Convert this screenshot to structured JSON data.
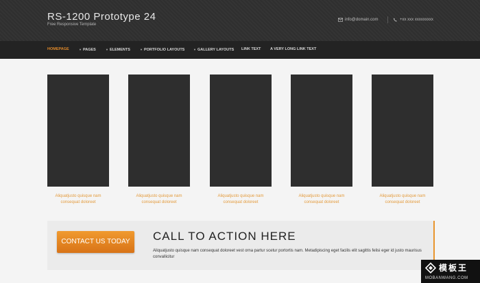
{
  "header": {
    "site_title": "RS-1200 Prototype 24",
    "site_subtitle": "Free Responsive Template",
    "email": "info@domain.com",
    "phone": "+xx xxx xxxxxxxxx"
  },
  "nav": {
    "items": [
      {
        "label": "HOMEPAGE",
        "active": true
      },
      {
        "label": "PAGES",
        "dropdown": true
      },
      {
        "label": "ELEMENTS",
        "dropdown": true
      },
      {
        "label": "PORTFOLIO LAYOUTS",
        "dropdown": true
      },
      {
        "label": "GALLERY LAYOUTS",
        "dropdown": true
      },
      {
        "label": "LINK TEXT"
      },
      {
        "label": "A VERY LONG LINK TEXT"
      }
    ]
  },
  "cards": [
    {
      "caption_line1": "Aliquatjusto quisque nam",
      "caption_line2": "consequat doloreet"
    },
    {
      "caption_line1": "Aliquatjusto quisque nam",
      "caption_line2": "consequat doloreet"
    },
    {
      "caption_line1": "Aliquatjusto quisque nam",
      "caption_line2": "consequat doloreet"
    },
    {
      "caption_line1": "Aliquatjusto quisque nam",
      "caption_line2": "consequat doloreet"
    },
    {
      "caption_line1": "Aliquatjusto quisque nam",
      "caption_line2": "consequat doloreet"
    }
  ],
  "cta": {
    "button_label": "CONTACT US TODAY",
    "title": "CALL TO ACTION HERE",
    "text": "Aliquatjusto quisque nam consequat doloreet vest orna partur scetur portortis nam. Metadipiscing eget facilis elit sagittis felisi eger id justo maurisus convallicitur"
  },
  "watermark": {
    "text": "模板王",
    "url": "MOBANWANG.COM"
  },
  "colors": {
    "accent": "#e0892a",
    "header_bg": "#2f2f2f",
    "nav_bg": "#232323",
    "thumb_bg": "#2e2e2e",
    "caption": "#e39a3b"
  },
  "icons": {
    "email": "envelope-icon",
    "phone": "phone-icon"
  }
}
